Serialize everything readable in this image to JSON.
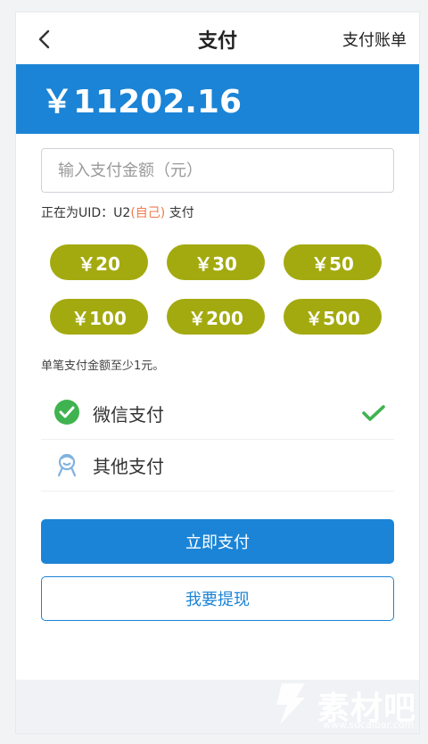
{
  "header": {
    "title": "支付",
    "bill_link": "支付账单",
    "back_icon": "chevron-left-icon"
  },
  "balance": {
    "amount": "￥11202.16",
    "bg_color": "#1b84d6"
  },
  "amount_input": {
    "placeholder": "输入支付金额（元）",
    "value": ""
  },
  "uid_line": {
    "prefix": "正在为UID：U2",
    "self": "(自己)",
    "suffix": " 支付"
  },
  "presets": [
    "￥20",
    "￥30",
    "￥50",
    "￥100",
    "￥200",
    "￥500"
  ],
  "note": "单笔支付金额至少1元。",
  "payment_methods": [
    {
      "label": "微信支付",
      "icon": "wechat-pay-icon",
      "selected": true
    },
    {
      "label": "其他支付",
      "icon": "other-pay-icon",
      "selected": false
    }
  ],
  "buttons": {
    "pay_now": "立即支付",
    "withdraw": "我要提现"
  },
  "watermark": {
    "brand": "素材吧",
    "url": "www.sucaibar.com"
  },
  "colors": {
    "accent": "#1b84d6",
    "chip": "#a3aa0f",
    "wechat_green": "#3fb34f",
    "self_tag": "#f07a4d"
  }
}
